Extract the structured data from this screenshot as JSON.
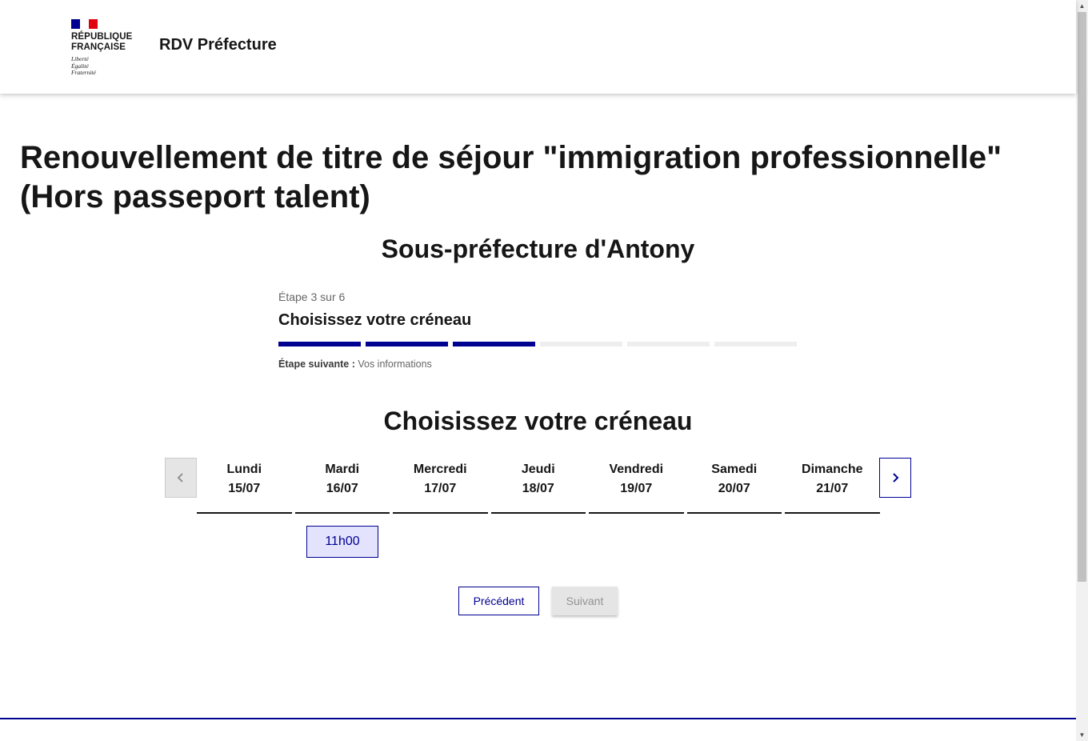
{
  "header": {
    "marianne": [
      "RÉPUBLIQUE",
      "FRANÇAISE"
    ],
    "devise": [
      "Liberté",
      "Égalité",
      "Fraternité"
    ],
    "service_title": "RDV Préfecture"
  },
  "main": {
    "title": "Renouvellement de titre de séjour \"immigration professionnelle\" (Hors passeport talent)",
    "site_title": "Sous-préfecture d'Antony"
  },
  "stepper": {
    "state": "Étape 3 sur 6",
    "title": "Choisissez votre créneau",
    "current_step": 3,
    "total_steps": 6,
    "next_label": "Étape suivante :",
    "next_value": "Vos informations"
  },
  "calendar": {
    "section_title": "Choisissez votre créneau",
    "days": [
      {
        "name": "Lundi",
        "date": "15/07"
      },
      {
        "name": "Mardi",
        "date": "16/07"
      },
      {
        "name": "Mercredi",
        "date": "17/07"
      },
      {
        "name": "Jeudi",
        "date": "18/07"
      },
      {
        "name": "Vendredi",
        "date": "19/07"
      },
      {
        "name": "Samedi",
        "date": "20/07"
      },
      {
        "name": "Dimanche",
        "date": "21/07"
      }
    ],
    "slots": [
      {
        "day": "Mardi",
        "time": "11h00"
      }
    ],
    "prev_icon": "chevron-left-icon",
    "next_icon": "chevron-right-icon"
  },
  "actions": {
    "previous_label": "Précédent",
    "next_label": "Suivant"
  },
  "colors": {
    "primary": "#000091",
    "slot_background": "#e3e3fd",
    "disabled": "#e5e5e5",
    "flag_red": "#e1000f"
  }
}
